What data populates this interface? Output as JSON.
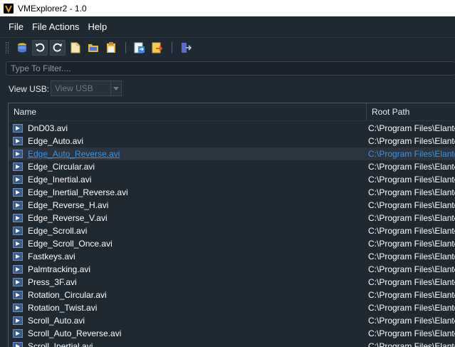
{
  "window": {
    "title": "VMExplorer2 - 1.0"
  },
  "menu": {
    "items": [
      "File",
      "File Actions",
      "Help"
    ]
  },
  "toolbar": {
    "buttons": [
      "database-icon",
      "undo-icon",
      "redo-icon",
      "new-file-icon",
      "open-folder-icon",
      "paste-icon",
      "export-icon",
      "import-icon",
      "exit-icon"
    ]
  },
  "filter": {
    "placeholder": "Type To Filter...."
  },
  "view_usb": {
    "label": "View USB:",
    "value": "View USB"
  },
  "table": {
    "columns": [
      "Name",
      "Root Path"
    ],
    "selected_index": 2,
    "rows": [
      {
        "name": "DnD03.avi",
        "path": "C:\\Program Files\\Elante"
      },
      {
        "name": "Edge_Auto.avi",
        "path": "C:\\Program Files\\Elante"
      },
      {
        "name": "Edge_Auto_Reverse.avi",
        "path": "C:\\Program Files\\Elante"
      },
      {
        "name": "Edge_Circular.avi",
        "path": "C:\\Program Files\\Elante"
      },
      {
        "name": "Edge_Inertial.avi",
        "path": "C:\\Program Files\\Elante"
      },
      {
        "name": "Edge_Inertial_Reverse.avi",
        "path": "C:\\Program Files\\Elante"
      },
      {
        "name": "Edge_Reverse_H.avi",
        "path": "C:\\Program Files\\Elante"
      },
      {
        "name": "Edge_Reverse_V.avi",
        "path": "C:\\Program Files\\Elante"
      },
      {
        "name": "Edge_Scroll.avi",
        "path": "C:\\Program Files\\Elante"
      },
      {
        "name": "Edge_Scroll_Once.avi",
        "path": "C:\\Program Files\\Elante"
      },
      {
        "name": "Fastkeys.avi",
        "path": "C:\\Program Files\\Elante"
      },
      {
        "name": "Palmtracking.avi",
        "path": "C:\\Program Files\\Elante"
      },
      {
        "name": "Press_3F.avi",
        "path": "C:\\Program Files\\Elante"
      },
      {
        "name": "Rotation_Circular.avi",
        "path": "C:\\Program Files\\Elante"
      },
      {
        "name": "Rotation_Twist.avi",
        "path": "C:\\Program Files\\Elante"
      },
      {
        "name": "Scroll_Auto.avi",
        "path": "C:\\Program Files\\Elante"
      },
      {
        "name": "Scroll_Auto_Reverse.avi",
        "path": "C:\\Program Files\\Elante"
      },
      {
        "name": "Scroll_Inertial.avi",
        "path": "C:\\Program Files\\Elante"
      }
    ]
  }
}
